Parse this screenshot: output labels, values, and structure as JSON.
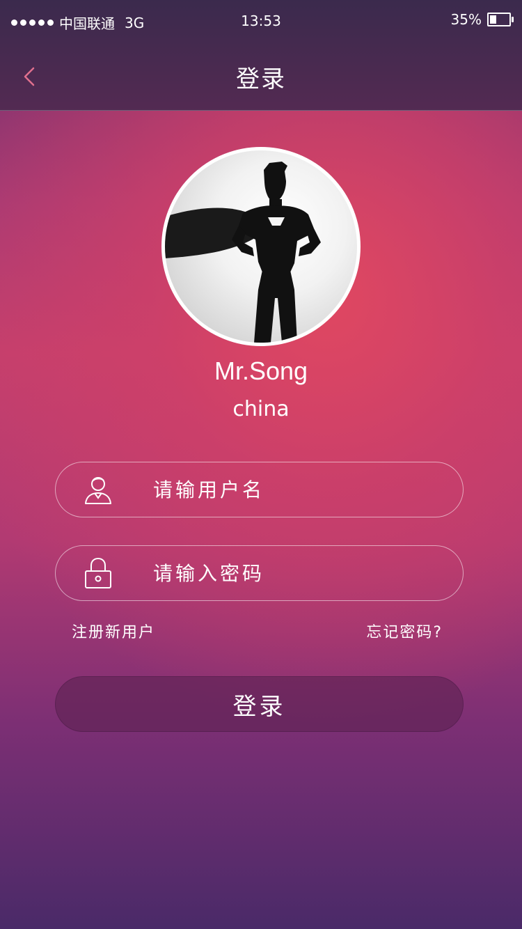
{
  "status_bar": {
    "carrier": "中国联通",
    "network": "3G",
    "time": "13:53",
    "battery_percent": "35%",
    "battery_level": 0.35,
    "signal_dots": 5
  },
  "nav": {
    "title": "登录",
    "back_icon": "chevron-left-icon",
    "back_icon_color": "#e0708e"
  },
  "profile": {
    "name": "Mr.Song",
    "region": "china"
  },
  "form": {
    "username_placeholder": "请输用户名",
    "password_placeholder": "请输入密码",
    "username_icon": "user-icon",
    "password_icon": "lock-icon"
  },
  "links": {
    "register": "注册新用户",
    "forgot": "忘记密码?"
  },
  "login_button": "登录",
  "colors": {
    "accent": "#d8456a",
    "button_bg": "#6a2a5e",
    "nav_bg": "#4a2a4f"
  }
}
